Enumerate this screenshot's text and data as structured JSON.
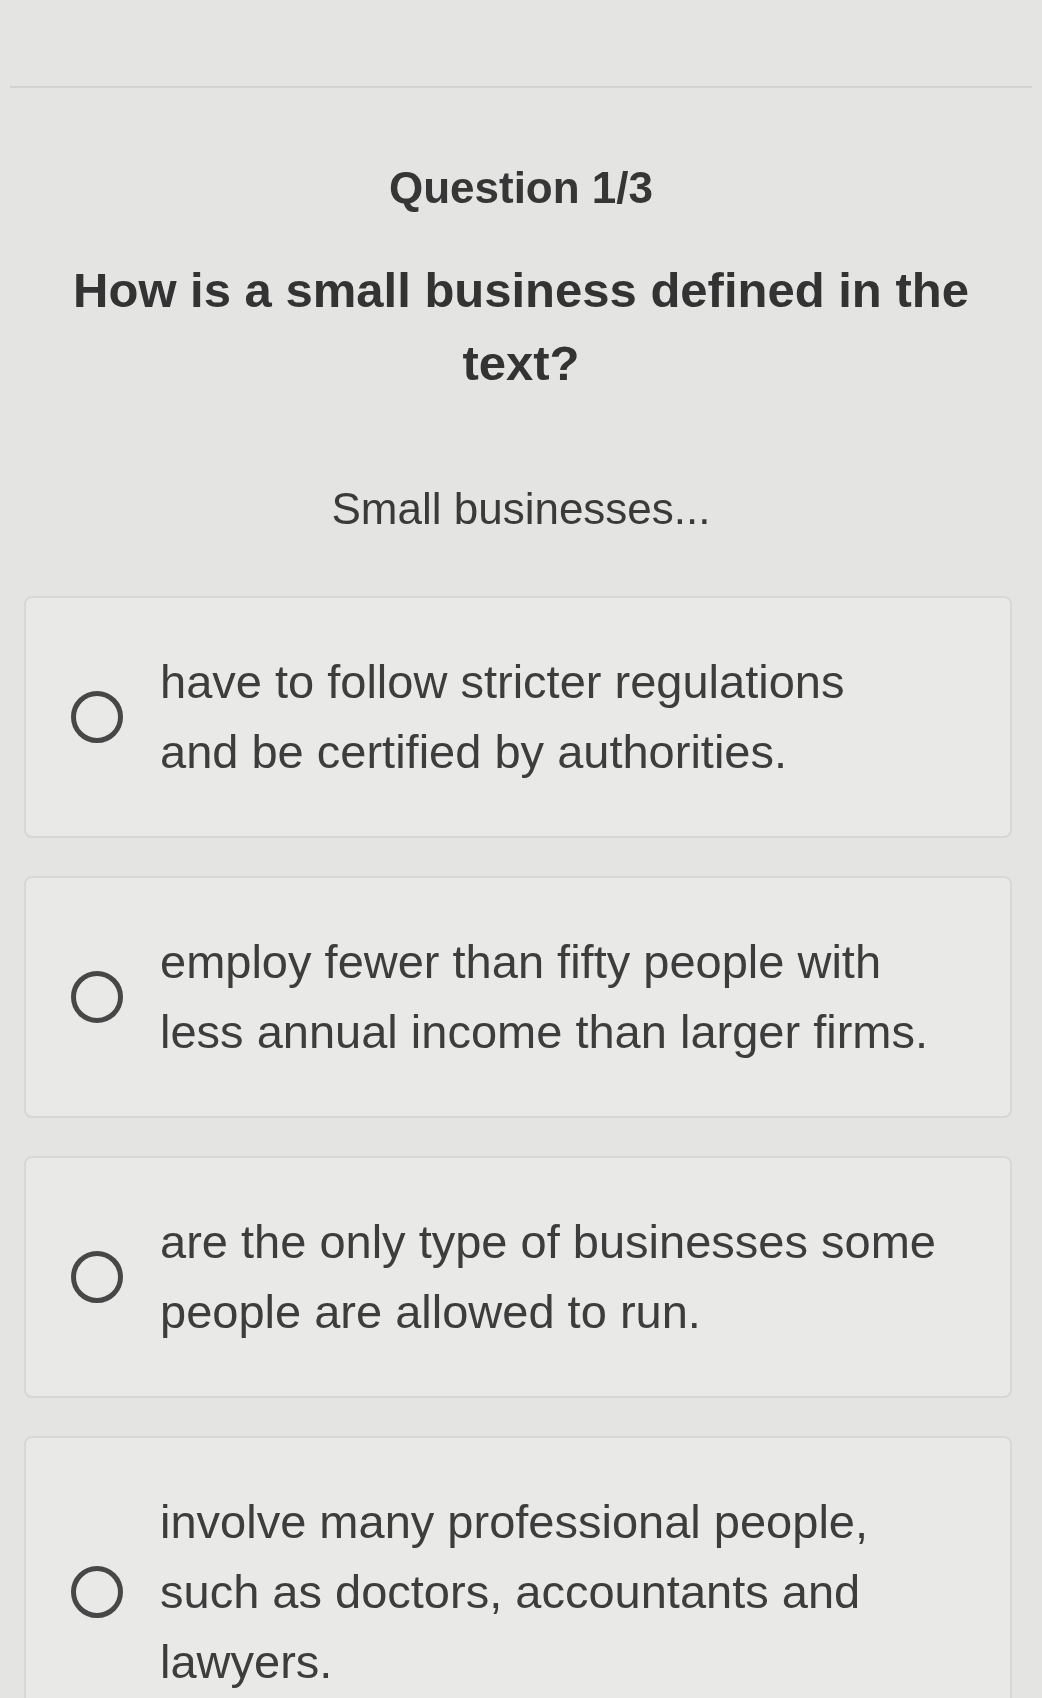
{
  "question": {
    "counter": "Question 1/3",
    "prompt": "How is a small business defined in the text?",
    "stem": "Small businesses..."
  },
  "options": [
    {
      "text": "have to follow stricter regulations\nand be certified by authorities.",
      "selected": false
    },
    {
      "text": "employ fewer than fifty people with\nless annual income than larger firms.",
      "selected": false
    },
    {
      "text": "are the only type of businesses some\npeople are allowed to run.",
      "selected": false
    },
    {
      "text": "involve many professional people,\nsuch as doctors, accountants and\nlawyers.",
      "selected": false
    }
  ]
}
